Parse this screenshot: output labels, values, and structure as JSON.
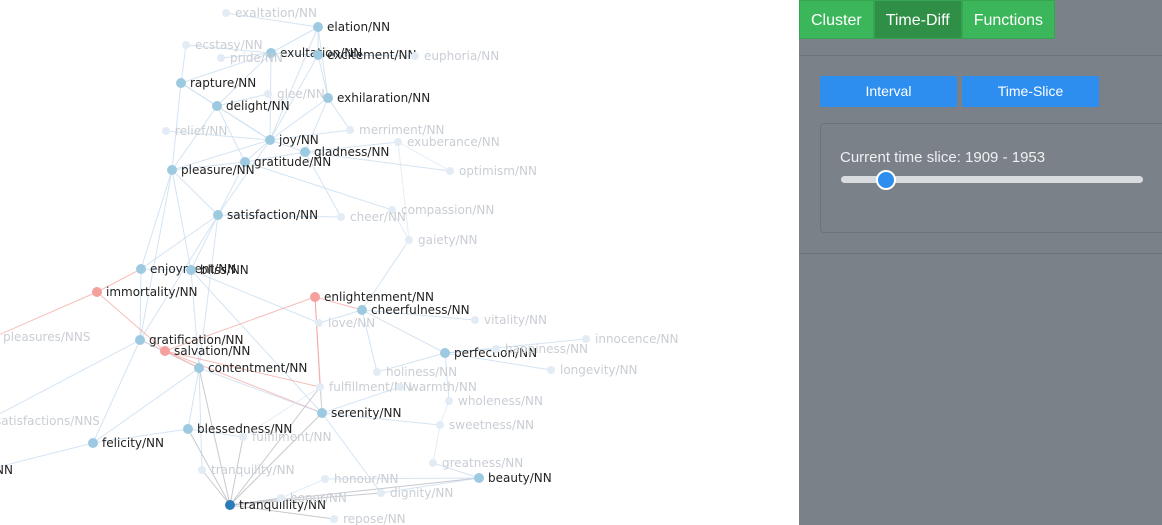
{
  "tabs": [
    {
      "label": "Cluster",
      "active": false
    },
    {
      "label": "Time-Diff",
      "active": true
    },
    {
      "label": "Functions",
      "active": false
    }
  ],
  "buttons": {
    "interval": "Interval",
    "time_slice": "Time-Slice"
  },
  "slider": {
    "label": "Current time slice: 1909 - 1953",
    "value": 0.15
  },
  "colors": {
    "blue_node": "#9ecae1",
    "red_node": "#f4a09c",
    "dark_node": "#2b7bb9",
    "panel_bg": "#7b8189",
    "green_tab": "#3cb65a",
    "blue_button": "#2d8ef0"
  },
  "graph": {
    "nodes": [
      {
        "id": "elation",
        "label": "elation/NN",
        "kind": "blue"
      },
      {
        "id": "exultation",
        "label": "exultation/NN",
        "kind": "blue"
      },
      {
        "id": "excitement",
        "label": "excitement/NN",
        "kind": "blue"
      },
      {
        "id": "rapture",
        "label": "rapture/NN",
        "kind": "blue"
      },
      {
        "id": "delight",
        "label": "delight/NN",
        "kind": "blue"
      },
      {
        "id": "exhilaration",
        "label": "exhilaration/NN",
        "kind": "blue"
      },
      {
        "id": "joy",
        "label": "joy/NN",
        "kind": "blue"
      },
      {
        "id": "gladness",
        "label": "gladness/NN",
        "kind": "blue"
      },
      {
        "id": "gratitude",
        "label": "gratitude/NN",
        "kind": "blue"
      },
      {
        "id": "pleasure",
        "label": "pleasure/NN",
        "kind": "blue"
      },
      {
        "id": "satisfaction",
        "label": "satisfaction/NN",
        "kind": "blue"
      },
      {
        "id": "enjoyment",
        "label": "enjoyment/NN",
        "kind": "blue"
      },
      {
        "id": "bliss",
        "label": "bliss/NN",
        "kind": "blue"
      },
      {
        "id": "immortality",
        "label": "immortality/NN",
        "kind": "red"
      },
      {
        "id": "enlightenment",
        "label": "enlightenment/NN",
        "kind": "red"
      },
      {
        "id": "cheerfulness",
        "label": "cheerfulness/NN",
        "kind": "blue"
      },
      {
        "id": "gratification",
        "label": "gratification/NN",
        "kind": "blue"
      },
      {
        "id": "salvation",
        "label": "salvation/NN",
        "kind": "red"
      },
      {
        "id": "perfection",
        "label": "perfection/NN",
        "kind": "blue"
      },
      {
        "id": "contentment",
        "label": "contentment/NN",
        "kind": "blue"
      },
      {
        "id": "serenity",
        "label": "serenity/NN",
        "kind": "blue"
      },
      {
        "id": "blessedness",
        "label": "blessedness/NN",
        "kind": "blue"
      },
      {
        "id": "felicity",
        "label": "felicity/NN",
        "kind": "blue"
      },
      {
        "id": "beauty",
        "label": "beauty/NN",
        "kind": "blue"
      },
      {
        "id": "tranquillity",
        "label": "tranquillity/NN",
        "kind": "dark"
      },
      {
        "id": "nn_cut",
        "label": "NN",
        "kind": "blue"
      },
      {
        "id": "f_exaltation",
        "label": "exaltation/NN",
        "kind": "faint"
      },
      {
        "id": "f_ecstasy",
        "label": "ecstasy/NN",
        "kind": "faint"
      },
      {
        "id": "f_pride",
        "label": "pride/NN",
        "kind": "faint"
      },
      {
        "id": "f_euphoria",
        "label": "euphoria/NN",
        "kind": "faint"
      },
      {
        "id": "f_glee",
        "label": "glee/NN",
        "kind": "faint"
      },
      {
        "id": "f_relief",
        "label": "relief/NN",
        "kind": "faint"
      },
      {
        "id": "f_merriment",
        "label": "merriment/NN",
        "kind": "faint"
      },
      {
        "id": "f_exuberance",
        "label": "exuberance/NN",
        "kind": "faint"
      },
      {
        "id": "f_optimism",
        "label": "optimism/NN",
        "kind": "faint"
      },
      {
        "id": "f_compassion",
        "label": "compassion/NN",
        "kind": "faint"
      },
      {
        "id": "f_cheer",
        "label": "cheer/NN",
        "kind": "faint"
      },
      {
        "id": "f_gaiety",
        "label": "gaiety/NN",
        "kind": "faint"
      },
      {
        "id": "f_love",
        "label": "love/NN",
        "kind": "faint"
      },
      {
        "id": "f_vitality",
        "label": "vitality/NN",
        "kind": "faint"
      },
      {
        "id": "f_innocence",
        "label": "innocence/NN",
        "kind": "faint"
      },
      {
        "id": "f_pleasures",
        "label": "pleasures/NNS",
        "kind": "faint"
      },
      {
        "id": "f_happiness",
        "label": "happiness/NN",
        "kind": "faint"
      },
      {
        "id": "f_longevity",
        "label": "longevity/NN",
        "kind": "faint"
      },
      {
        "id": "f_holiness",
        "label": "holiness/NN",
        "kind": "faint"
      },
      {
        "id": "f_fulfillment",
        "label": "fulfillment/NN",
        "kind": "faint"
      },
      {
        "id": "f_warmth",
        "label": "warmth/NN",
        "kind": "faint"
      },
      {
        "id": "f_wholeness",
        "label": "wholeness/NN",
        "kind": "faint"
      },
      {
        "id": "f_satisfactions",
        "label": "satisfactions/NNS",
        "kind": "faint"
      },
      {
        "id": "f_sweetness",
        "label": "sweetness/NN",
        "kind": "faint"
      },
      {
        "id": "f_fulfilment",
        "label": "fulfilment/NN",
        "kind": "faint"
      },
      {
        "id": "f_greatness",
        "label": "greatness/NN",
        "kind": "faint"
      },
      {
        "id": "f_tranquility",
        "label": "tranquility/NN",
        "kind": "faint"
      },
      {
        "id": "f_honour",
        "label": "honour/NN",
        "kind": "faint"
      },
      {
        "id": "f_honor",
        "label": "honor/NN",
        "kind": "faint"
      },
      {
        "id": "f_dignity",
        "label": "dignity/NN",
        "kind": "faint"
      },
      {
        "id": "f_repose",
        "label": "repose/NN",
        "kind": "faint"
      }
    ],
    "edges": [
      [
        "elation",
        "exultation"
      ],
      [
        "elation",
        "excitement"
      ],
      [
        "elation",
        "joy"
      ],
      [
        "elation",
        "f_exaltation"
      ],
      [
        "elation",
        "exhilaration"
      ],
      [
        "exultation",
        "excitement"
      ],
      [
        "exultation",
        "rapture"
      ],
      [
        "exultation",
        "delight"
      ],
      [
        "exultation",
        "joy"
      ],
      [
        "exultation",
        "f_ecstasy"
      ],
      [
        "exultation",
        "f_pride"
      ],
      [
        "excitement",
        "exhilaration"
      ],
      [
        "excitement",
        "f_euphoria"
      ],
      [
        "excitement",
        "joy"
      ],
      [
        "rapture",
        "delight"
      ],
      [
        "rapture",
        "joy"
      ],
      [
        "rapture",
        "pleasure"
      ],
      [
        "rapture",
        "f_ecstasy"
      ],
      [
        "delight",
        "joy"
      ],
      [
        "delight",
        "pleasure"
      ],
      [
        "delight",
        "gratitude"
      ],
      [
        "delight",
        "f_glee"
      ],
      [
        "exhilaration",
        "joy"
      ],
      [
        "exhilaration",
        "gladness"
      ],
      [
        "exhilaration",
        "f_merriment"
      ],
      [
        "joy",
        "gladness"
      ],
      [
        "joy",
        "gratitude"
      ],
      [
        "joy",
        "pleasure"
      ],
      [
        "joy",
        "satisfaction"
      ],
      [
        "joy",
        "f_relief"
      ],
      [
        "joy",
        "f_merriment"
      ],
      [
        "gladness",
        "gratitude"
      ],
      [
        "gladness",
        "f_exuberance"
      ],
      [
        "gladness",
        "f_cheer"
      ],
      [
        "gladness",
        "f_optimism"
      ],
      [
        "gratitude",
        "satisfaction"
      ],
      [
        "gratitude",
        "pleasure"
      ],
      [
        "gratitude",
        "f_compassion"
      ],
      [
        "pleasure",
        "satisfaction"
      ],
      [
        "pleasure",
        "enjoyment"
      ],
      [
        "pleasure",
        "bliss"
      ],
      [
        "pleasure",
        "gratification"
      ],
      [
        "satisfaction",
        "enjoyment"
      ],
      [
        "satisfaction",
        "bliss"
      ],
      [
        "satisfaction",
        "contentment"
      ],
      [
        "satisfaction",
        "f_cheer"
      ],
      [
        "satisfaction",
        "gratification"
      ],
      [
        "enjoyment",
        "bliss"
      ],
      [
        "enjoyment",
        "gratification"
      ],
      [
        "enjoyment",
        "immortality"
      ],
      [
        "bliss",
        "contentment"
      ],
      [
        "bliss",
        "serenity"
      ],
      [
        "bliss",
        "f_love"
      ],
      [
        "immortality",
        "salvation"
      ],
      [
        "immortality",
        "f_pleasures"
      ],
      [
        "enlightenment",
        "salvation"
      ],
      [
        "enlightenment",
        "cheerfulness"
      ],
      [
        "enlightenment",
        "serenity"
      ],
      [
        "enlightenment",
        "f_fulfillment"
      ],
      [
        "cheerfulness",
        "f_gaiety"
      ],
      [
        "cheerfulness",
        "perfection"
      ],
      [
        "cheerfulness",
        "f_love"
      ],
      [
        "cheerfulness",
        "f_holiness"
      ],
      [
        "cheerfulness",
        "f_vitality"
      ],
      [
        "perfection",
        "f_happiness"
      ],
      [
        "perfection",
        "f_wholeness"
      ],
      [
        "perfection",
        "f_holiness"
      ],
      [
        "perfection",
        "f_innocence"
      ],
      [
        "perfection",
        "f_longevity"
      ],
      [
        "gratification",
        "salvation"
      ],
      [
        "gratification",
        "contentment"
      ],
      [
        "gratification",
        "felicity"
      ],
      [
        "gratification",
        "f_satisfactions"
      ],
      [
        "salvation",
        "contentment"
      ],
      [
        "salvation",
        "f_fulfillment"
      ],
      [
        "salvation",
        "serenity"
      ],
      [
        "contentment",
        "serenity"
      ],
      [
        "contentment",
        "blessedness"
      ],
      [
        "contentment",
        "tranquillity"
      ],
      [
        "contentment",
        "f_tranquility"
      ],
      [
        "contentment",
        "felicity"
      ],
      [
        "serenity",
        "f_fulfillment"
      ],
      [
        "serenity",
        "f_warmth"
      ],
      [
        "serenity",
        "f_sweetness"
      ],
      [
        "serenity",
        "tranquillity"
      ],
      [
        "serenity",
        "f_dignity"
      ],
      [
        "blessedness",
        "f_fulfilment"
      ],
      [
        "blessedness",
        "tranquillity"
      ],
      [
        "blessedness",
        "felicity"
      ],
      [
        "f_fulfillment",
        "f_fulfilment"
      ],
      [
        "f_fulfilment",
        "tranquillity"
      ],
      [
        "f_fulfillment",
        "tranquillity"
      ],
      [
        "tranquillity",
        "f_tranquility"
      ],
      [
        "tranquillity",
        "f_honor"
      ],
      [
        "tranquillity",
        "f_repose"
      ],
      [
        "tranquillity",
        "f_dignity"
      ],
      [
        "tranquillity",
        "beauty"
      ],
      [
        "beauty",
        "f_greatness"
      ],
      [
        "beauty",
        "f_dignity"
      ],
      [
        "beauty",
        "f_honour"
      ],
      [
        "f_greatness",
        "f_sweetness"
      ],
      [
        "f_sweetness",
        "f_wholeness"
      ],
      [
        "f_honour",
        "f_honor"
      ],
      [
        "f_gaiety",
        "f_compassion"
      ],
      [
        "f_gaiety",
        "f_exuberance"
      ],
      [
        "f_optimism",
        "f_exuberance"
      ],
      [
        "felicity",
        "nn_cut"
      ],
      [
        "f_satisfactions",
        "nn_cut"
      ]
    ]
  }
}
